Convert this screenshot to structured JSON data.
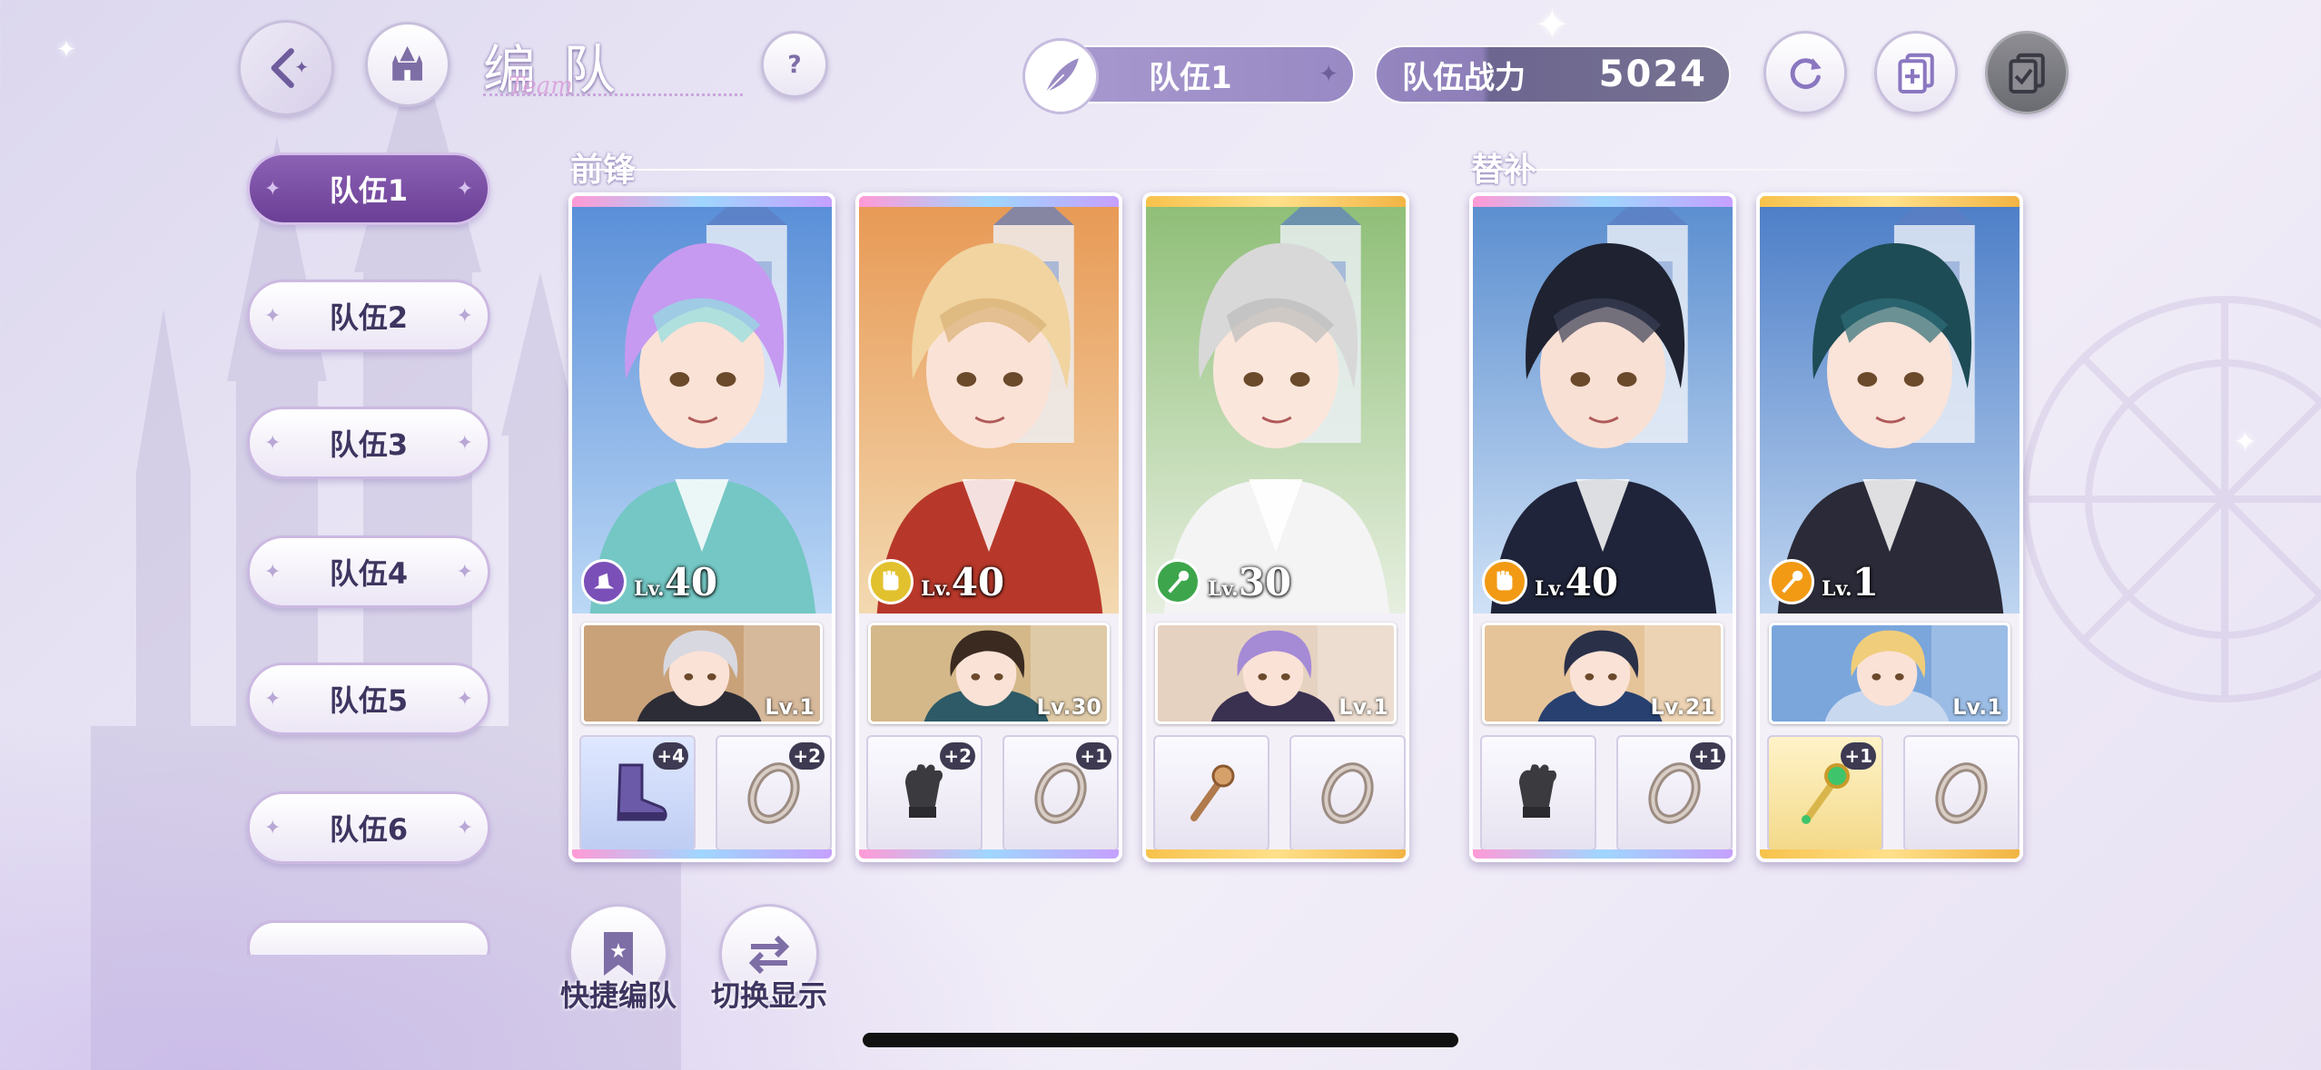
{
  "header": {
    "title": "编队",
    "title_script": "Team",
    "team_selector": "队伍1",
    "power_label": "队伍战力",
    "power_value": "5024"
  },
  "tabs": [
    "队伍1",
    "队伍2",
    "队伍3",
    "队伍4",
    "队伍5",
    "队伍6"
  ],
  "active_tab": 0,
  "sections": {
    "front": "前锋",
    "reserve": "替补"
  },
  "level_prefix": "Lv.",
  "cards": [
    {
      "level": "40",
      "class_icon": "hat-icon",
      "class_color": "#7a4fb8",
      "frame": "rainbow",
      "sub_level": "Lv.1",
      "equip1": {
        "icon": "boot-icon",
        "plus": "+4",
        "bg": "blue"
      },
      "equip2": {
        "icon": "ring-icon",
        "plus": "+2",
        "bg": "white"
      }
    },
    {
      "level": "40",
      "class_icon": "fist-icon",
      "class_color": "#e2c12f",
      "frame": "rainbow",
      "sub_level": "Lv.30",
      "equip1": {
        "icon": "glove-icon",
        "plus": "+2",
        "bg": "white"
      },
      "equip2": {
        "icon": "ring-icon",
        "plus": "+1",
        "bg": "white"
      }
    },
    {
      "level": "30",
      "class_icon": "staff-icon",
      "class_color": "#3da64c",
      "frame": "gold",
      "sub_level": "Lv.1",
      "equip1": {
        "icon": "scepter-icon",
        "plus": "",
        "bg": "white"
      },
      "equip2": {
        "icon": "ring-icon",
        "plus": "",
        "bg": "white"
      }
    },
    {
      "level": "40",
      "class_icon": "fist-icon",
      "class_color": "#f29a14",
      "frame": "rainbow",
      "sub_level": "Lv.21",
      "equip1": {
        "icon": "glove-icon",
        "plus": "",
        "bg": "white"
      },
      "equip2": {
        "icon": "ring-icon",
        "plus": "+1",
        "bg": "white"
      }
    },
    {
      "level": "1",
      "class_icon": "staff-icon",
      "class_color": "#f29a14",
      "frame": "gold",
      "sub_level": "Lv.1",
      "equip1": {
        "icon": "green-scepter-icon",
        "plus": "+1",
        "bg": "gold"
      },
      "equip2": {
        "icon": "ring-icon",
        "plus": "",
        "bg": "white"
      }
    }
  ],
  "bottom": {
    "quick_label": "快捷编队",
    "switch_label": "切换显示"
  }
}
